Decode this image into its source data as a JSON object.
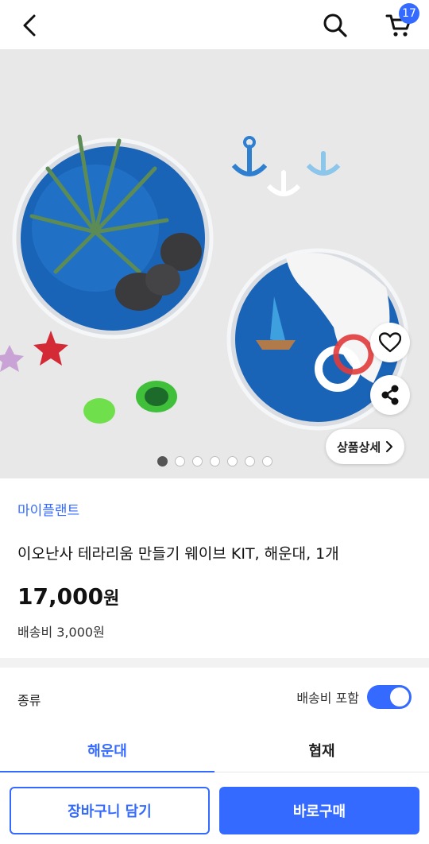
{
  "header": {
    "cart_count": "17"
  },
  "gallery": {
    "detail_label": "상품상세",
    "page_count": 7,
    "active_page": 1
  },
  "product": {
    "brand": "마이플랜트",
    "title": "이오난사 테라리움 만들기 웨이브 KIT, 해운대, 1개",
    "price_number": "17,000",
    "price_unit": "원",
    "shipping": "배송비 3,000원"
  },
  "options": {
    "label": "종류",
    "toggle_label": "배송비 포함",
    "toggle_on": true
  },
  "tabs": [
    {
      "label": "해운대",
      "active": true
    },
    {
      "label": "협재",
      "active": false
    }
  ],
  "actions": {
    "add_to_cart": "장바구니 담기",
    "buy_now": "바로구매"
  },
  "colors": {
    "accent": "#346aff"
  }
}
